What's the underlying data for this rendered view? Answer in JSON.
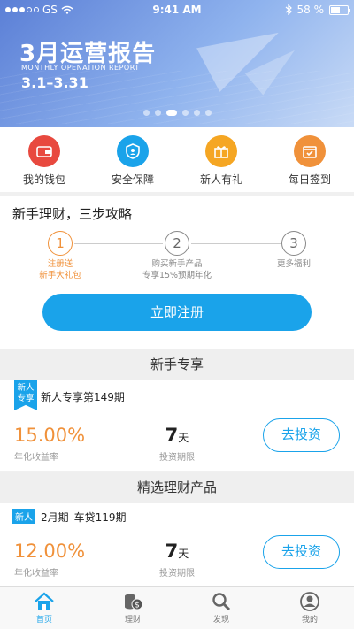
{
  "status_bar": {
    "carrier": "GS",
    "time": "9:41 AM",
    "battery": "58 %",
    "battery_level": 0.58
  },
  "banner": {
    "title": "3月运营报告",
    "subtitle": "MONTHLY OPENATION REPORT",
    "date_range": "3.1–3.31",
    "page_count": 6,
    "active_page": 3
  },
  "quick_menu": [
    {
      "label": "我的钱包",
      "icon": "wallet-icon",
      "color": "#e8493f"
    },
    {
      "label": "安全保障",
      "icon": "shield-icon",
      "color": "#1aa3ea"
    },
    {
      "label": "新人有礼",
      "icon": "gift-icon",
      "color": "#f5a623"
    },
    {
      "label": "每日签到",
      "icon": "calendar-icon",
      "color": "#f0913a"
    }
  ],
  "guide": {
    "title": "新手理财，三步攻略",
    "steps": [
      {
        "num": "1",
        "line1": "注册送",
        "line2": "新手大礼包"
      },
      {
        "num": "2",
        "line1": "购买新手产品",
        "line2": "专享15%预期年化"
      },
      {
        "num": "3",
        "line1": "更多福利",
        "line2": ""
      }
    ],
    "register_label": "立即注册"
  },
  "section_new": "新手专享",
  "section_select": "精选理财产品",
  "product1": {
    "tag": "新人专享",
    "name": "新人专享第149期",
    "rate": "15.00%",
    "rate_label": "年化收益率",
    "days": "7",
    "days_unit": "天",
    "days_label": "投资期限",
    "button": "去投资"
  },
  "product2": {
    "tag": "新人",
    "name": "2月期–车贷119期",
    "rate": "12.00%",
    "rate_label": "年化收益率",
    "days": "7",
    "days_unit": "天",
    "days_label": "投资期限",
    "button": "去投资"
  },
  "tabbar": [
    {
      "label": "首页",
      "icon": "home-icon"
    },
    {
      "label": "理财",
      "icon": "coins-icon"
    },
    {
      "label": "发现",
      "icon": "magnifier-icon"
    },
    {
      "label": "我的",
      "icon": "user-icon"
    }
  ],
  "colors": {
    "accent": "#1aa3ea",
    "orange": "#f0913a"
  }
}
